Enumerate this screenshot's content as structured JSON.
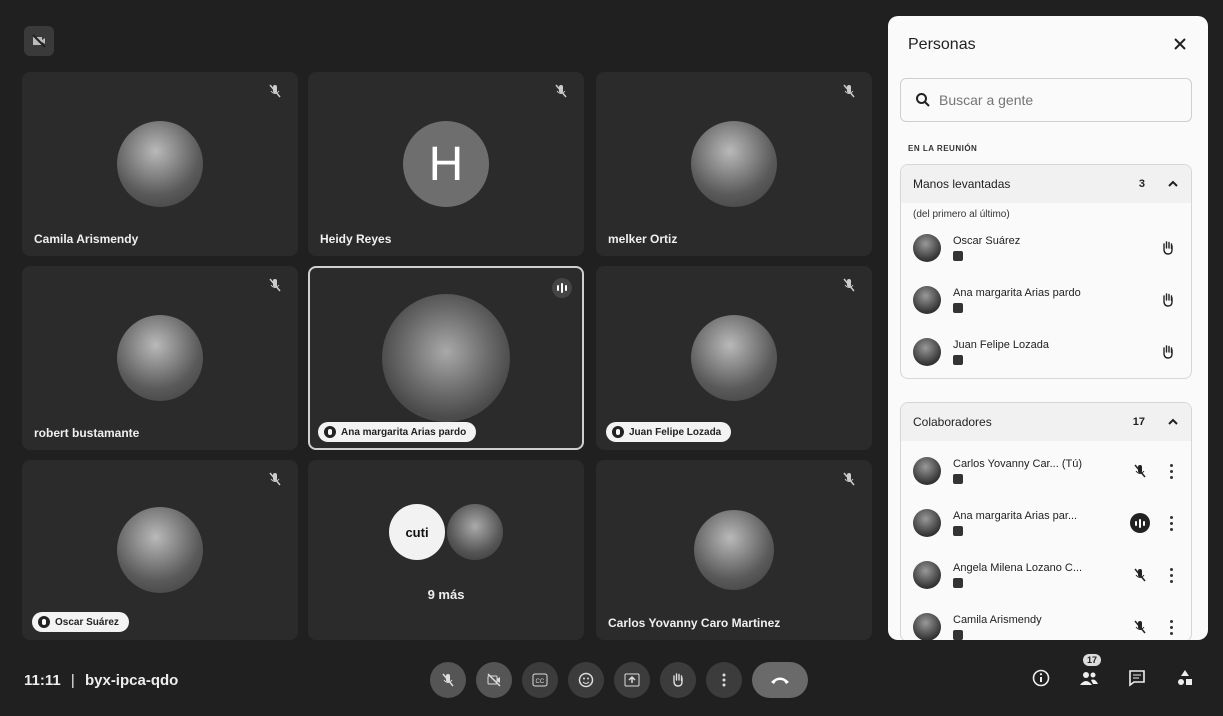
{
  "meeting": {
    "time": "11:11",
    "separator": "|",
    "code": "byx-ipca-qdo"
  },
  "tiles": [
    {
      "name": "Camila Arismendy",
      "type": "photo"
    },
    {
      "name": "Heidy Reyes",
      "type": "letter",
      "letter": "H"
    },
    {
      "name": "melker Ortiz",
      "type": "photo"
    },
    {
      "name": "robert bustamante",
      "type": "photo"
    },
    {
      "name": "Ana margarita Arias pardo",
      "type": "photo",
      "hand_raised": true,
      "speaking": true
    },
    {
      "name": "Juan Felipe Lozada",
      "type": "photo",
      "hand_raised": true
    },
    {
      "name": "Oscar Suárez",
      "type": "photo",
      "hand_raised": true
    },
    {
      "name": "",
      "type": "group",
      "more_label": "9 más",
      "logo_text": "cuti"
    },
    {
      "name": "Carlos Yovanny Caro Martinez",
      "type": "photo"
    }
  ],
  "panel": {
    "title": "Personas",
    "search_placeholder": "Buscar a gente",
    "section_label": "EN LA REUNIÓN",
    "raised_hands": {
      "title": "Manos levantadas",
      "count": "3",
      "subtitle": "(del primero al último)",
      "people": [
        {
          "name": "Oscar Suárez"
        },
        {
          "name": "Ana margarita Arias pardo"
        },
        {
          "name": "Juan Felipe Lozada"
        }
      ]
    },
    "collaborators": {
      "title": "Colaboradores",
      "count": "17",
      "people": [
        {
          "name": "Carlos Yovanny Car...  (Tú)",
          "status": "mic-off"
        },
        {
          "name": "Ana margarita Arias par...",
          "status": "speaking"
        },
        {
          "name": "Angela Milena Lozano C...",
          "status": "mic-off"
        },
        {
          "name": "Camila Arismendy",
          "status": "mic-off"
        }
      ]
    }
  },
  "toolbar": {
    "people_badge": "17"
  },
  "colors": {
    "background": "#202020",
    "tile": "#2b2b2b",
    "panel": "#fafafa"
  }
}
